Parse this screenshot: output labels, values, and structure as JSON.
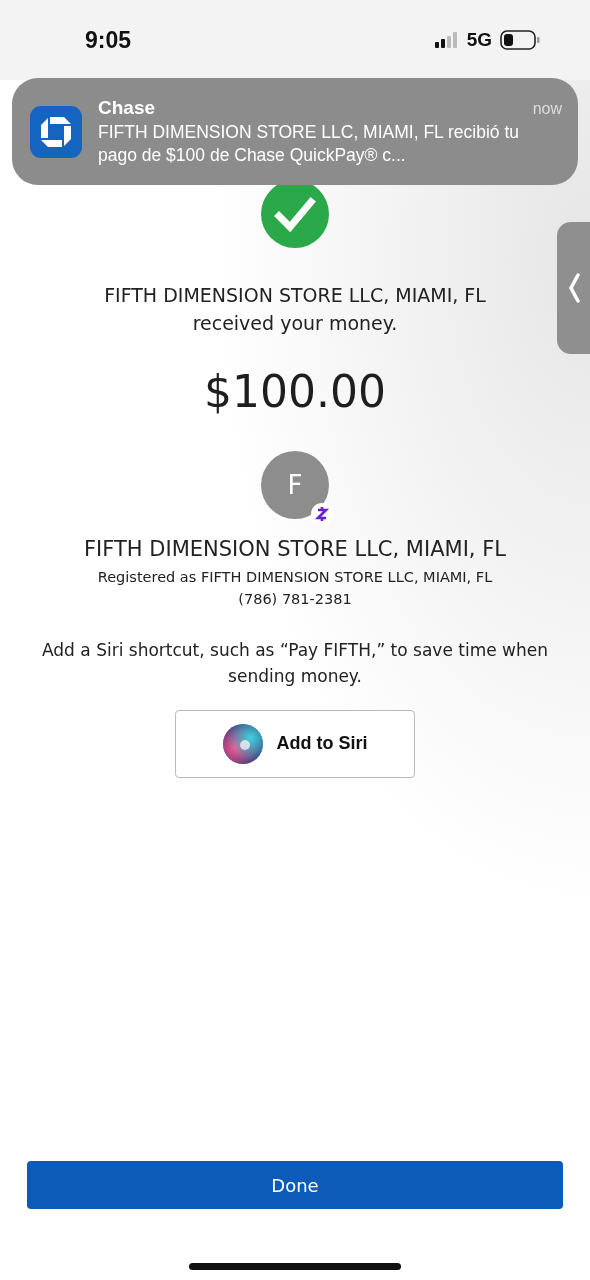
{
  "status_bar": {
    "time": "9:05",
    "network": "5G"
  },
  "notification": {
    "app": "Chase",
    "time": "now",
    "message": "FIFTH DIMENSION STORE LLC, MIAMI, FL recibió tu pago de $100 de Chase QuickPay® c..."
  },
  "confirmation": {
    "recipient": "FIFTH DIMENSION STORE LLC, MIAMI, FL",
    "message": "received your money.",
    "amount": "$100.00"
  },
  "recipient": {
    "initial": "F",
    "name": "FIFTH DIMENSION STORE LLC, MIAMI, FL",
    "registered": "Registered as FIFTH DIMENSION STORE LLC, MIAMI, FL",
    "phone": "(786) 781-2381"
  },
  "siri": {
    "prompt": "Add a Siri shortcut, such as “Pay FIFTH,” to save time when sending money.",
    "button": "Add to Siri"
  },
  "done_button": "Done"
}
